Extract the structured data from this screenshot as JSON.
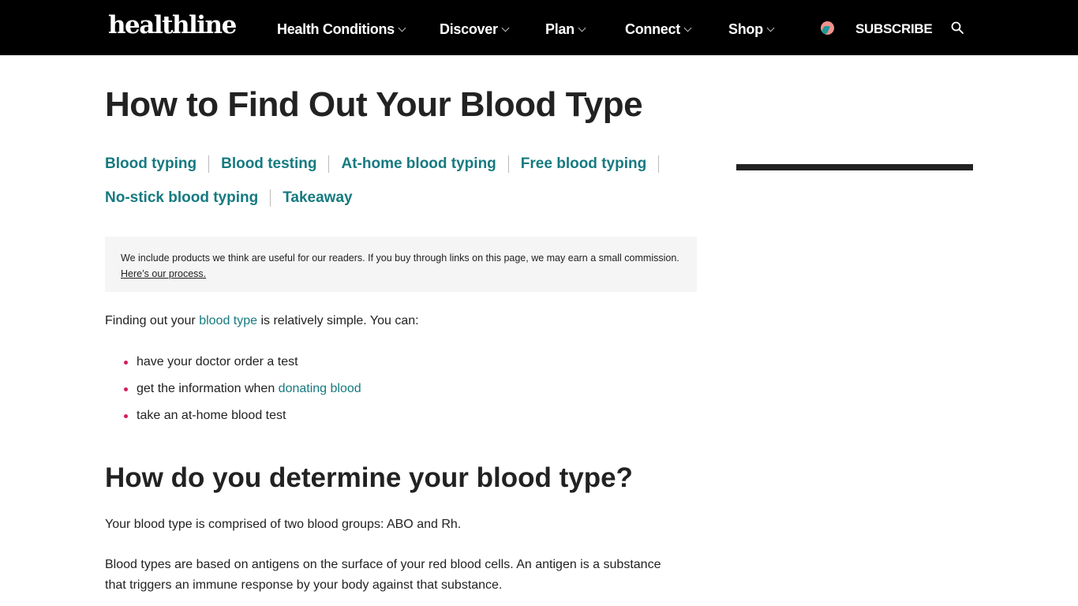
{
  "header": {
    "logo": "healthline",
    "nav": [
      {
        "label": "Health Conditions"
      },
      {
        "label": "Discover"
      },
      {
        "label": "Plan"
      },
      {
        "label": "Connect"
      },
      {
        "label": "Shop"
      }
    ],
    "promo_icon": "promo-badge-icon",
    "subscribe_label": "SUBSCRIBE",
    "search_icon": "search-icon"
  },
  "article": {
    "title": "How to Find Out Your Blood Type",
    "toc": [
      {
        "label": "Blood typing"
      },
      {
        "label": "Blood testing"
      },
      {
        "label": "At-home blood typing"
      },
      {
        "label": "Free blood typing"
      },
      {
        "label": "No-stick blood typing"
      },
      {
        "label": "Takeaway"
      }
    ],
    "disclosure": {
      "text": "We include products we think are useful for our readers. If you buy through links on this page, we may earn a small commission.",
      "link": "Here’s our process."
    },
    "intro": {
      "before": "Finding out your ",
      "link": "blood type",
      "after": " is relatively simple. You can:"
    },
    "bullets": [
      {
        "text": "have your doctor order a test",
        "link": ""
      },
      {
        "text": "get the information when ",
        "link": "donating blood"
      },
      {
        "text": "take an at-home blood test",
        "link": ""
      }
    ],
    "section_heading": "How do you determine your blood type?",
    "paragraphs": [
      "Your blood type is comprised of two blood groups: ABO and Rh.",
      "Blood types are based on antigens on the surface of your red blood cells. An antigen is a substance that triggers an immune response by your body against that substance."
    ]
  },
  "colors": {
    "header_bg": "#000000",
    "link": "#157a80",
    "bullet": "#d81b60",
    "disclosure_bg": "#f5f5f5"
  }
}
